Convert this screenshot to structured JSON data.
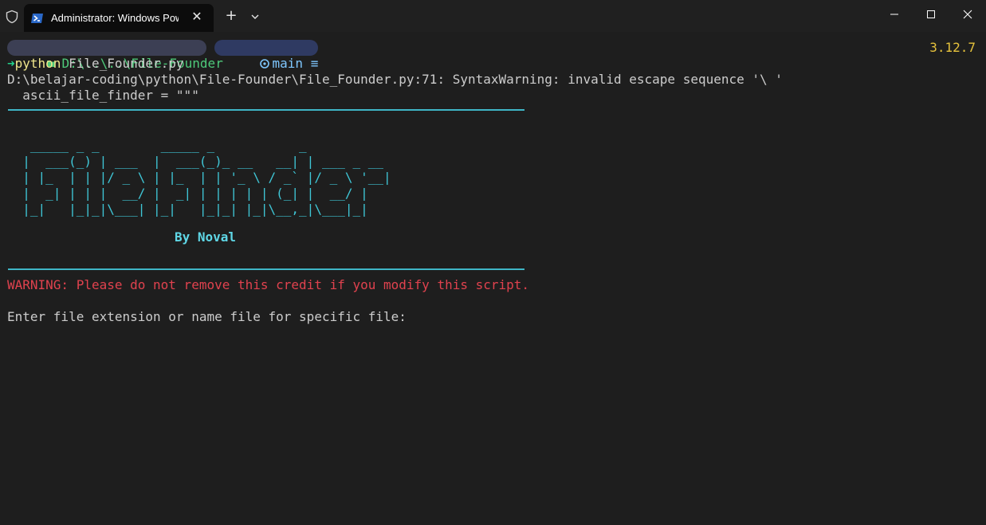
{
  "titlebar": {
    "tab_title": "Administrator: Windows PowerShell",
    "new_tab_label": "+"
  },
  "prompt": {
    "path": "D:\\..\\..\\File-Founder",
    "branch": "main ≡",
    "python_version": "3.12.7",
    "arrow": "➜",
    "command": "python",
    "args": " File_Founder.py"
  },
  "output": {
    "warning_line": "D:\\belajar-coding\\python\\File-Founder\\File_Founder.py:71: SyntaxWarning: invalid escape sequence '\\ '",
    "code_line": "  ascii_file_finder = \"\"\"",
    "ascii_art": "   _____ _ _        _____ _           _\n  |  ___(_) | ___  |  ___(_)_ __   __| | ___ _ __\n  | |_  | | |/ _ \\ | |_  | | '_ \\ / _` |/ _ \\ '__|\n  |  _| | | |  __/ |  _| | | | | | (_| |  __/ |\n  |_|   |_|_|\\___| |_|   |_|_| |_|\\__,_|\\___|_|",
    "credit": "By Noval",
    "credit_warning": "WARNING: Please do not remove this credit if you modify this script.",
    "input_prompt": "Enter file extension or name file for specific file:"
  },
  "colors": {
    "accent": "#3fc6d6",
    "warning": "#e0424e",
    "version": "#e6c23c",
    "path": "#4ec97a"
  }
}
